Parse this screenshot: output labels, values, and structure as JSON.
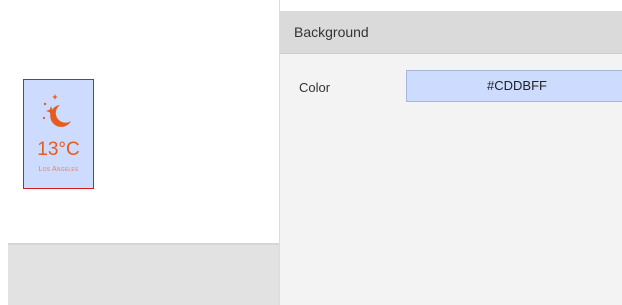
{
  "canvas": {
    "widget": {
      "icon": "moon-stars-icon",
      "temperature": "13°C",
      "city": "Los Angeles",
      "accent_color": "#E65C1C",
      "background_color": "#CDDBFF",
      "selection_color": "#D8171F"
    }
  },
  "panel": {
    "section_title": "Background",
    "properties": [
      {
        "label": "Color",
        "value": "#CDDBFF"
      }
    ]
  }
}
